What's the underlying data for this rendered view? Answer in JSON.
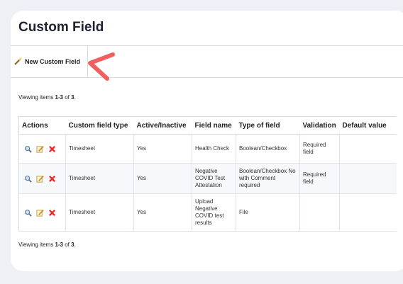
{
  "page": {
    "title": "Custom Field"
  },
  "toolbar": {
    "new_label": "New Custom Field"
  },
  "viewing": {
    "prefix": "Viewing items ",
    "range": "1-3",
    "mid": " of ",
    "total": "3",
    "suffix": "."
  },
  "table": {
    "headers": [
      "Actions",
      "Custom field type",
      "Active/Inactive",
      "Field name",
      "Type of field",
      "Validation",
      "Default value"
    ],
    "rows": [
      {
        "type": "Timesheet",
        "active": "Yes",
        "name": "Health Check",
        "field_type": "Boolean/Checkbox",
        "validation": "Required field",
        "default": ""
      },
      {
        "type": "Timesheet",
        "active": "Yes",
        "name": "Negative COVID Test Attestation",
        "field_type": "Boolean/Checkbox No with Comment required",
        "validation": "Required field",
        "default": ""
      },
      {
        "type": "Timesheet",
        "active": "Yes",
        "name": "Upload Negative COVID test results",
        "field_type": "File",
        "validation": "",
        "default": ""
      }
    ]
  },
  "icons": {
    "view": "magnifier-icon",
    "edit": "edit-icon",
    "delete": "delete-icon",
    "new": "wand-icon"
  },
  "colors": {
    "accent_arrow": "#f0605e",
    "delete": "#e0302b"
  }
}
